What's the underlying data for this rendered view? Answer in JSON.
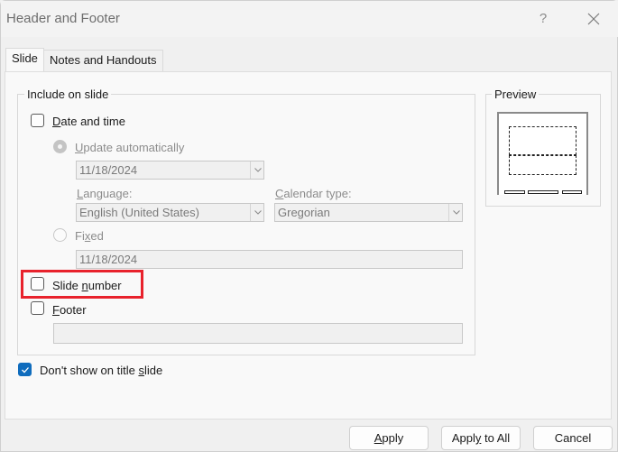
{
  "window": {
    "title": "Header and Footer",
    "help_label": "?",
    "close_icon": "close-icon"
  },
  "tabs": [
    {
      "label": "Slide",
      "selected": true
    },
    {
      "label": "Notes and Handouts",
      "selected": false
    }
  ],
  "include_group": {
    "label": "Include on slide",
    "date_and_time": {
      "label": "Date and time",
      "accesskey": "D",
      "checked": false
    },
    "update_automatically": {
      "label": "Update automatically",
      "accesskey": "U",
      "selected": true,
      "enabled": false
    },
    "date_select": {
      "value": "11/18/2024",
      "enabled": false
    },
    "language": {
      "label": "Language:",
      "accesskey": "L",
      "value": "English (United States)"
    },
    "calendar_type": {
      "label": "Calendar type:",
      "accesskey": "C",
      "value": "Gregorian"
    },
    "fixed": {
      "label": "Fixed",
      "accesskey": "x",
      "selected": false
    },
    "fixed_value": "11/18/2024",
    "slide_number": {
      "label": "Slide number",
      "accesskey": "n",
      "checked": false,
      "highlighted": true
    },
    "footer": {
      "label": "Footer",
      "accesskey": "F",
      "checked": false,
      "value": ""
    }
  },
  "dont_show_title": {
    "label": "Don't show on title slide",
    "accesskey": "s",
    "checked": true
  },
  "preview": {
    "label": "Preview"
  },
  "buttons": {
    "apply": "Apply",
    "apply_to_all": "Apply to All",
    "cancel": "Cancel"
  },
  "colors": {
    "accent": "#0f6cbd",
    "highlight": "#e8222c"
  }
}
